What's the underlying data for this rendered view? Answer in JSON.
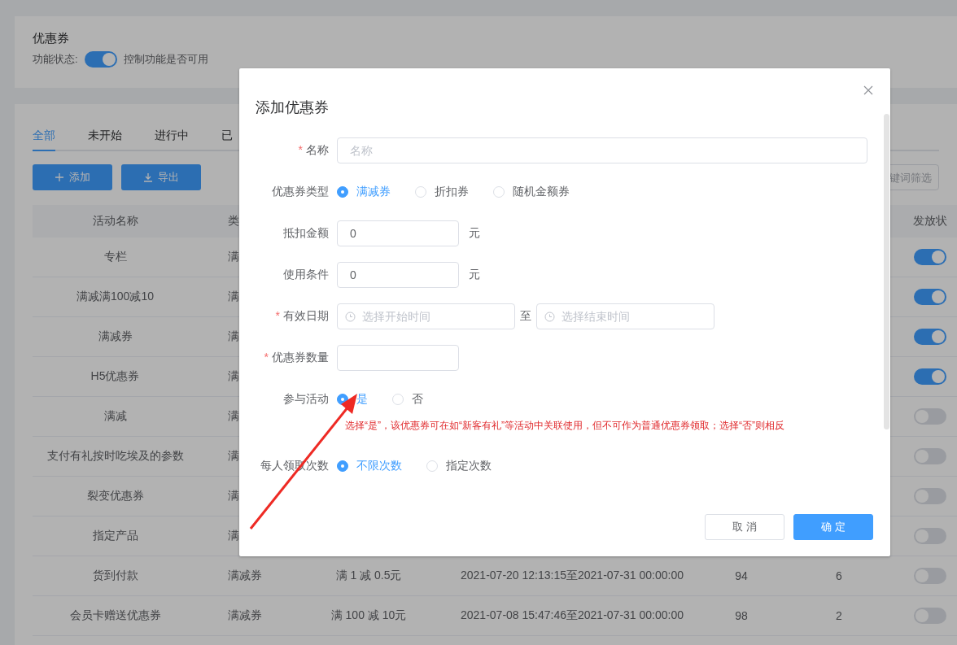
{
  "page": {
    "title": "优惠券",
    "feature_label": "功能状态:",
    "feature_on": true,
    "feature_hint": "控制功能是否可用"
  },
  "tabs": [
    {
      "label": "全部",
      "selected": true
    },
    {
      "label": "未开始",
      "selected": false
    },
    {
      "label": "进行中",
      "selected": false
    },
    {
      "label": "已",
      "selected": false
    }
  ],
  "toolbar": {
    "buttons": [
      {
        "label": "添加"
      },
      {
        "label": "导出"
      }
    ],
    "search": {
      "placeholder": "键词筛选"
    }
  },
  "table": {
    "header": {
      "column_1": "活动名称",
      "column_2": "类",
      "column_7": "发放状"
    },
    "rows": [
      {
        "column_1": "专栏",
        "column_2": "满",
        "issuing": true
      },
      {
        "column_1": "满减满100减10",
        "column_2": "满",
        "issuing": true
      },
      {
        "column_1": "满减券",
        "column_2": "满",
        "issuing": true
      },
      {
        "column_1": "H5优惠券",
        "column_2": "满",
        "issuing": true
      },
      {
        "column_1": "满减",
        "column_2": "满",
        "issuing": false
      },
      {
        "column_1": "支付有礼按时吃埃及的参数",
        "column_2": "满",
        "issuing": false
      },
      {
        "column_1": "裂变优惠券",
        "column_2": "满",
        "issuing": false
      },
      {
        "column_1": "指定产品",
        "column_2": "满",
        "issuing": false
      },
      {
        "column_1": "货到付款",
        "column_2": "满减券",
        "column_3": "满 1 减 0.5元",
        "column_4": "2021-07-20 12:13:15至2021-07-31 00:00:00",
        "column_5": "94",
        "column_6": "6",
        "issuing": false
      },
      {
        "column_1": "会员卡赠送优惠券",
        "column_2": "满减券",
        "column_3": "满 100 减 10元",
        "column_4": "2021-07-08 15:47:46至2021-07-31 00:00:00",
        "column_5": "98",
        "column_6": "2",
        "issuing": false
      }
    ]
  },
  "dialog": {
    "title": "添加优惠券",
    "required_mark": "*",
    "fields": [
      {
        "kind": "text",
        "label": "名称",
        "required": true,
        "placeholder": "名称"
      },
      {
        "kind": "radio",
        "label": "优惠券类型",
        "required": false,
        "options": [
          {
            "label": "满减券",
            "selected": true
          },
          {
            "label": "折扣券",
            "selected": false
          },
          {
            "label": "随机金额券",
            "selected": false
          }
        ]
      },
      {
        "kind": "amount",
        "label": "抵扣金额",
        "required": false,
        "value": "0",
        "unit": "元"
      },
      {
        "kind": "amount",
        "label": "使用条件",
        "required": false,
        "value": "0",
        "unit": "元"
      },
      {
        "kind": "daterange",
        "label": "有效日期",
        "required": true,
        "start_placeholder": "选择开始时间",
        "separator": "至",
        "end_placeholder": "选择结束时间"
      },
      {
        "kind": "amount",
        "label": "优惠券数量",
        "required": true
      },
      {
        "kind": "radio",
        "label": "参与活动",
        "required": false,
        "options": [
          {
            "label": "是",
            "selected": true
          },
          {
            "label": "否",
            "selected": false
          }
        ],
        "hint": "选择“是”，该优惠券可在如“新客有礼”等活动中关联使用，但不可作为普通优惠券领取；选择“否”则相反"
      },
      {
        "kind": "radio",
        "label": "每人领取次数",
        "required": false,
        "options": [
          {
            "label": "不限次数",
            "selected": true
          },
          {
            "label": "指定次数",
            "selected": false
          }
        ]
      }
    ],
    "buttons": [
      {
        "label": "取 消",
        "kind": "default"
      },
      {
        "label": "确 定",
        "kind": "primary"
      }
    ]
  }
}
